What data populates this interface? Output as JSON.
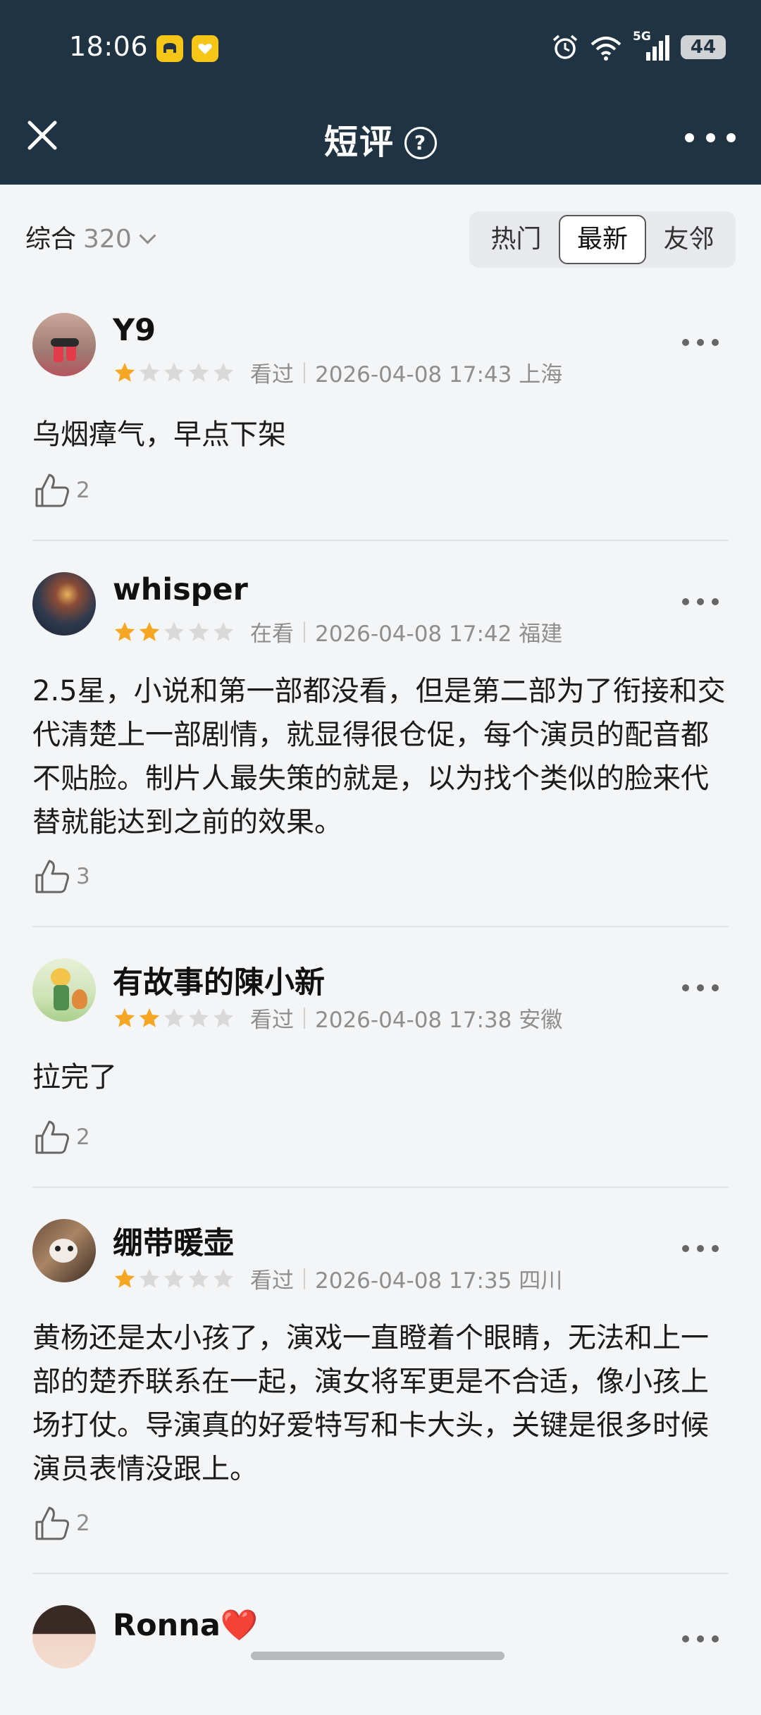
{
  "status_bar": {
    "time": "18:06",
    "network": "5G",
    "battery": "44"
  },
  "nav": {
    "title": "短评",
    "help_glyph": "?"
  },
  "filter": {
    "sort_label": "综合",
    "count": "320",
    "tabs": [
      {
        "label": "热门",
        "active": false
      },
      {
        "label": "最新",
        "active": true
      },
      {
        "label": "友邻",
        "active": false
      }
    ]
  },
  "reviews": [
    {
      "user": "Y9",
      "rating": 1,
      "status": "看过",
      "datetime": "2026-04-08 17:43 上海",
      "text": "乌烟瘴气，早点下架",
      "likes": "2"
    },
    {
      "user": "whisper",
      "rating": 2,
      "status": "在看",
      "datetime": "2026-04-08 17:42 福建",
      "text": "2.5星，小说和第一部都没看，但是第二部为了衔接和交代清楚上一部剧情，就显得很仓促，每个演员的配音都不贴脸。制片人最失策的就是，以为找个类似的脸来代替就能达到之前的效果。",
      "likes": "3"
    },
    {
      "user": "有故事的陳小新",
      "rating": 2,
      "status": "看过",
      "datetime": "2026-04-08 17:38 安徽",
      "text": "拉完了",
      "likes": "2"
    },
    {
      "user": "绷带暖壶",
      "rating": 1,
      "status": "看过",
      "datetime": "2026-04-08 17:35 四川",
      "text": "黄杨还是太小孩了，演戏一直瞪着个眼睛，无法和上一部的楚乔联系在一起，演女将军更是不合适，像小孩上场打仗。导演真的好爱特写和卡大头，关键是很多时候演员表情没跟上。",
      "likes": "2"
    },
    {
      "user": "Ronna❤️"
    }
  ],
  "colors": {
    "header_bg": "#1f3342",
    "star_on": "#f5a623",
    "star_off": "#d9d9d9"
  }
}
